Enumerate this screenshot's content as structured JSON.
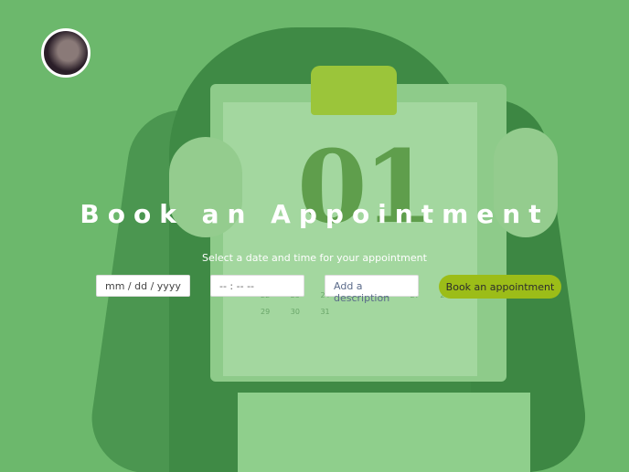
{
  "header": {
    "avatar_alt": "profile photo"
  },
  "hero": {
    "title": "Book an Appointment",
    "subtitle": "Select a date and time for your appointment",
    "bg_number": "01",
    "bg_calendar": "22 23 24 25 26 27 28\n29 30 31"
  },
  "form": {
    "date_placeholder": "mm / dd / yyyy",
    "time_placeholder": "-- : --  --",
    "description_placeholder": "Add a description",
    "submit_label": "Book an appointment"
  },
  "colors": {
    "overlay": "#6cb86c",
    "button": "#9cbd18"
  }
}
